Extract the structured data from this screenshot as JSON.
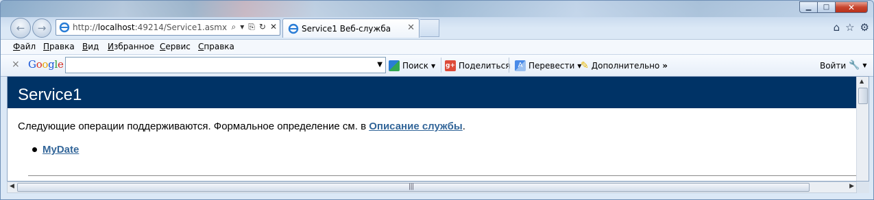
{
  "window": {
    "controls": [
      "min",
      "max",
      "close"
    ]
  },
  "address_bar": {
    "url_prefix": "http://",
    "url_host": "localhost",
    "url_rest": ":49214/Service1.asmx",
    "search_icon": "magnifier-icon",
    "refresh_icon": "refresh-icon",
    "stop_icon": "stop-icon"
  },
  "tab": {
    "label": "Service1 Веб-служба"
  },
  "menu": {
    "file": "Файл",
    "edit": "Правка",
    "view": "Вид",
    "favorites": "Избранное",
    "tools": "Сервис",
    "help": "Справка"
  },
  "google_bar": {
    "close": "×",
    "logo_letters": [
      "G",
      "o",
      "o",
      "g",
      "l",
      "e"
    ],
    "search_value": "",
    "search_label": "Поиск",
    "share_label": "Поделиться",
    "translate_label": "Перевести",
    "more_label": "Дополнительно",
    "signin_label": "Войти"
  },
  "page": {
    "title": "Service1",
    "intro_text": "Следующие операции поддерживаются. Формальное определение см. в",
    "intro_link": "Описание службы",
    "intro_end": ".",
    "operations": [
      "MyDate"
    ]
  },
  "colors": {
    "header_bg": "#003366",
    "link": "#336699",
    "close_btn": "#c7452e"
  }
}
